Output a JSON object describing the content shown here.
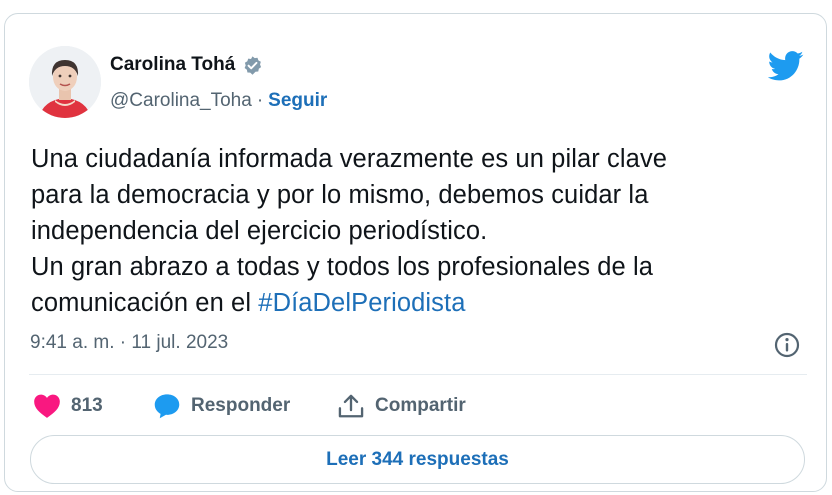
{
  "author": {
    "name": "Carolina Tohá",
    "handle": "@Carolina_Toha",
    "separator": "·",
    "follow_label": "Seguir"
  },
  "tweet": {
    "lines": [
      "Una ciudadanía informada verazmente es un pilar clave",
      "para la democracia y por lo mismo, debemos cuidar la",
      "independencia del ejercicio periodístico.",
      "Un gran abrazo a todas y todos los profesionales de la",
      "comunicación en el "
    ],
    "hashtag": "#DíaDelPeriodista",
    "timestamp": "9:41 a. m. · 11 jul. 2023"
  },
  "actions": {
    "like_count": "813",
    "reply_label": "Responder",
    "share_label": "Compartir"
  },
  "footer": {
    "read_replies_label": "Leer 344 respuestas"
  },
  "icons": {
    "verified": "verified-badge-icon",
    "brand": "twitter-bird-icon",
    "info": "info-icon",
    "like": "heart-icon",
    "reply": "speech-bubble-icon",
    "share": "share-upload-icon"
  },
  "colors": {
    "link_blue": "#1d6fb8",
    "twitter_blue": "#1d9bf0",
    "like_pink": "#f91880",
    "muted_text": "#536471",
    "border": "#cfd9de"
  }
}
